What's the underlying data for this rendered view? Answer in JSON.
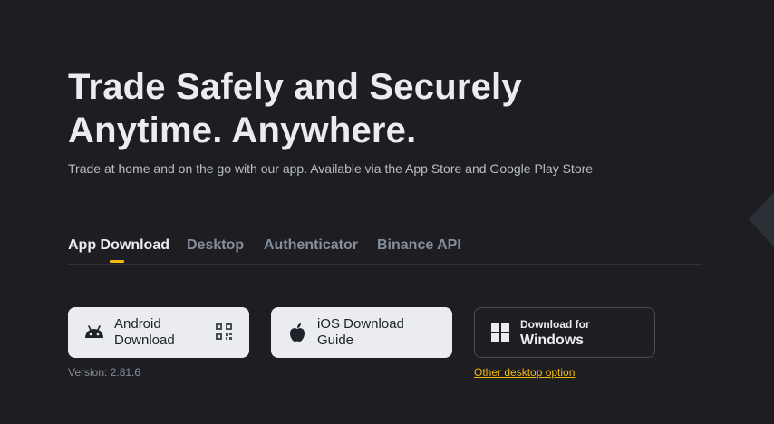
{
  "hero": {
    "title_line1": "Trade Safely and Securely",
    "title_line2": "Anytime. Anywhere.",
    "subtitle": "Trade at home and on the go with our app. Available via the App Store and Google Play Store"
  },
  "tabs": [
    {
      "label": "App Download",
      "active": true
    },
    {
      "label": "Desktop",
      "active": false
    },
    {
      "label": "Authenticator",
      "active": false
    },
    {
      "label": "Binance API",
      "active": false
    }
  ],
  "buttons": {
    "android": {
      "line1": "Android",
      "line2": "Download",
      "icon": "android-icon",
      "qr_icon": "qr-code-icon"
    },
    "ios": {
      "line1": "iOS Download",
      "line2": "Guide",
      "icon": "apple-icon"
    },
    "windows": {
      "small": "Download for",
      "big": "Windows",
      "icon": "windows-icon"
    }
  },
  "version": "Version: 2.81.6",
  "other_desktop_link": "Other desktop option",
  "colors": {
    "background": "#1e1e22",
    "accent": "#f0b90b",
    "light_button": "#eaecef"
  }
}
